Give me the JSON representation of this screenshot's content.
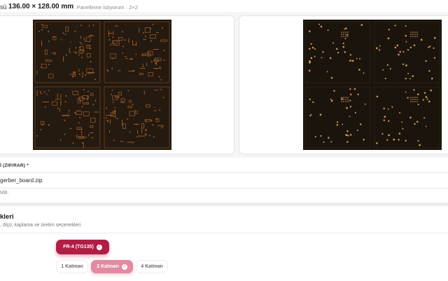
{
  "dimensions": {
    "label_prefix": "sü",
    "value": "136.00 × 128.00 mm",
    "note": "· Panelleme İstiyorum · 2×2"
  },
  "previews": {
    "top_board": "top-layer-render",
    "bottom_board": "bottom-layer-render",
    "colors": {
      "board": "#241a10",
      "copper": "#b46a2e",
      "bottom_board": "#1b140c",
      "bottom_pads": "#c99a5e"
    }
  },
  "file": {
    "label": "İ (ZIP/RAR) *",
    "file_name": "gerber_board.zip",
    "hint": "MB."
  },
  "options": {
    "title": "kleri",
    "subtitle": ", ölçü, kaplama ve üretim seçenekleri",
    "material": {
      "label": "FR-4 (TG135)",
      "selected": true
    },
    "layers": [
      {
        "label": "1 Katman",
        "selected": false
      },
      {
        "label": "2 Katman",
        "selected": true
      },
      {
        "label": "4 Katman",
        "selected": false
      }
    ],
    "accent_color": "#b01e45"
  }
}
